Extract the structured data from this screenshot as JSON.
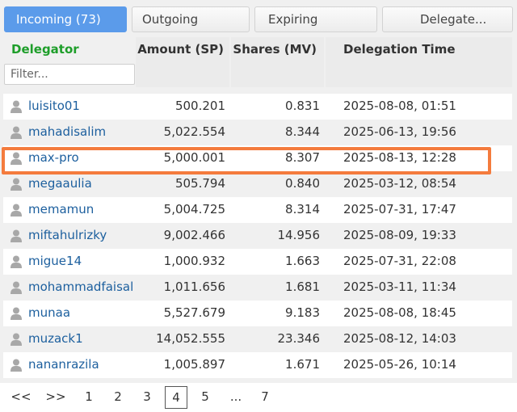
{
  "tabs": [
    {
      "label": "Incoming (73)",
      "active": true
    },
    {
      "label": "Outgoing",
      "active": false
    },
    {
      "label": "Expiring",
      "active": false
    },
    {
      "label": "Delegate...",
      "active": false
    }
  ],
  "table": {
    "headers": {
      "delegator": "Delegator",
      "amount": "Amount (SP)",
      "shares": "Shares (MV)",
      "time": "Delegation Time"
    },
    "filter_placeholder": "Filter...",
    "rows": [
      {
        "name": "luisito01",
        "amount": "500.201",
        "shares": "0.831",
        "time": "2025-08-08, 01:51"
      },
      {
        "name": "mahadisalim",
        "amount": "5,022.554",
        "shares": "8.344",
        "time": "2025-06-13, 19:56"
      },
      {
        "name": "max-pro",
        "amount": "5,000.001",
        "shares": "8.307",
        "time": "2025-08-13, 12:28"
      },
      {
        "name": "megaaulia",
        "amount": "505.794",
        "shares": "0.840",
        "time": "2025-03-12, 08:54"
      },
      {
        "name": "memamun",
        "amount": "5,004.725",
        "shares": "8.314",
        "time": "2025-07-31, 17:47"
      },
      {
        "name": "miftahulrizky",
        "amount": "9,002.466",
        "shares": "14.956",
        "time": "2025-08-09, 19:33"
      },
      {
        "name": "migue14",
        "amount": "1,000.932",
        "shares": "1.663",
        "time": "2025-07-31, 22:08"
      },
      {
        "name": "mohammadfaisal",
        "amount": "1,011.656",
        "shares": "1.681",
        "time": "2025-03-11, 11:34"
      },
      {
        "name": "munaa",
        "amount": "5,527.679",
        "shares": "9.183",
        "time": "2025-08-08, 18:45"
      },
      {
        "name": "muzack1",
        "amount": "14,052.555",
        "shares": "23.346",
        "time": "2025-08-12, 14:03"
      },
      {
        "name": "nananrazila",
        "amount": "1,005.897",
        "shares": "1.671",
        "time": "2025-05-26, 10:14"
      }
    ],
    "highlighted_row": "max-pro"
  },
  "pagination": {
    "prev": "<<",
    "next": ">>",
    "pages": [
      "1",
      "2",
      "3",
      "4",
      "5",
      "...",
      "7"
    ],
    "current": "4"
  },
  "colors": {
    "active_tab": "#5b9bea",
    "header_green": "#1e9e2a",
    "link_blue": "#1c5f9e",
    "highlight_orange": "#f47b3d"
  },
  "icons": {
    "row_icon": "user-icon"
  }
}
